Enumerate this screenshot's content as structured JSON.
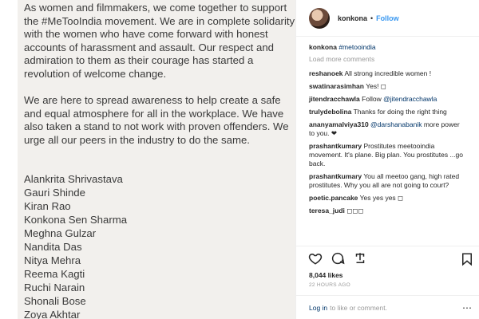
{
  "statement": {
    "paragraphs": [
      "As women and filmmakers, we come together to support the #MeTooIndia movement. We are in complete solidarity with the women who have come forward with honest accounts of harassment and assault. Our respect and admiration to them as their courage has started a revolution of welcome change.",
      "We are here to spread awareness to help create a safe and equal atmosphere for all in the workplace. We have also taken a stand to not work with proven offenders. We urge all our peers in the industry to do the same."
    ],
    "signatories": [
      "Alankrita Shrivastava",
      "Gauri Shinde",
      "Kiran Rao",
      "Konkona Sen Sharma",
      "Meghna Gulzar",
      "Nandita Das",
      "Nitya Mehra",
      "Reema Kagti",
      "Ruchi Narain",
      "Shonali Bose",
      "Zoya Akhtar"
    ]
  },
  "header": {
    "username": "konkona",
    "separator": "•",
    "follow_label": "Follow"
  },
  "caption": {
    "user": "konkona",
    "hashtag": "#metooindia"
  },
  "load_more_label": "Load more comments",
  "comments": [
    {
      "user": "reshanoek",
      "text": "All strong incredible women !",
      "mention": ""
    },
    {
      "user": "swatinarasimhan",
      "text": "Yes! ◻",
      "mention": ""
    },
    {
      "user": "jitendracchawla",
      "text": "Follow ",
      "mention": "@jitendracchawla"
    },
    {
      "user": "trulydebolina",
      "text": "Thanks for doing the right thing",
      "mention": ""
    },
    {
      "user": "ananyamalviya310",
      "text": "",
      "mention": "@darshanabanik",
      "after": " more power to you. ❤"
    },
    {
      "user": "prashantkumary",
      "text": "Prostitutes meetooindia movement. It's plane. Big plan. You prostitutes ...go back.",
      "mention": ""
    },
    {
      "user": "prashantkumary",
      "text": "You all meetoo gang, high rated prostitutes. Why you all are not going to court?",
      "mention": ""
    },
    {
      "user": "poetic.pancake",
      "text": "Yes yes yes ◻",
      "mention": ""
    },
    {
      "user": "teresa_judi",
      "text": "◻◻◻",
      "mention": ""
    }
  ],
  "likes": "8,044 likes",
  "timestamp": "22 HOURS AGO",
  "login_bar": {
    "login_label": "Log in",
    "rest": "to like or comment."
  },
  "icons": [
    "heart-icon",
    "comment-icon",
    "share-icon",
    "bookmark-icon",
    "more-icon"
  ]
}
